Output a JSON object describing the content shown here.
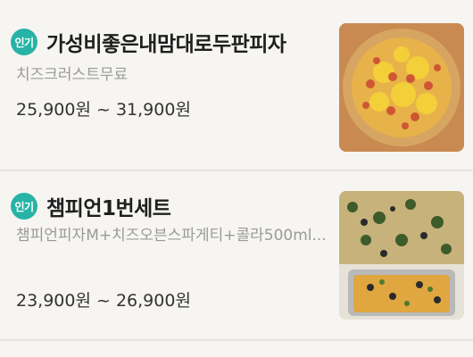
{
  "items": [
    {
      "badge": "인기",
      "title": "가성비좋은내맘대로두판피자",
      "description": "치즈크러스트무료",
      "price": "25,900원 ~ 31,900원",
      "image_icon": "pizza-photo"
    },
    {
      "badge": "인기",
      "title": "챔피언1번세트",
      "description": "챔피언피자M+치즈오븐스파게티+콜라500ml...",
      "price": "23,900원 ~ 26,900원",
      "image_icon": "pizza-set-photo"
    }
  ],
  "colors": {
    "badge": "#27b3a6",
    "background": "#f6f5f2",
    "divider": "#e6e4df"
  }
}
